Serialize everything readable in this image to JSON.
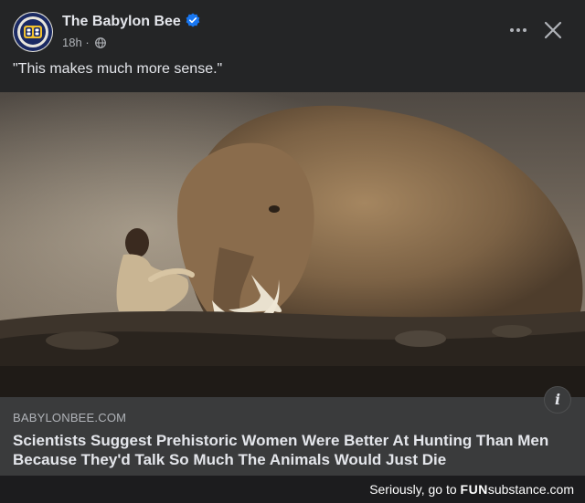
{
  "post": {
    "author": "The Babylon Bee",
    "time": "18h",
    "separator": "·",
    "caption": "\"This makes much more sense.\""
  },
  "icons": {
    "verified": "verified-badge-icon",
    "audience": "globe-icon",
    "more": "more-options-icon",
    "close": "close-icon",
    "info": "info-icon"
  },
  "link": {
    "domain": "BABYLONBEE.COM",
    "headline": "Scientists Suggest Prehistoric Women Were Better At Hunting Than Men Because They'd Talk So Much The Animals Would Just Die",
    "info_glyph": "i"
  },
  "watermark": {
    "lead": "Seriously, go to ",
    "brand_fun": "FUN",
    "brand_substance": "substance",
    "tld": ".com"
  },
  "colors": {
    "background": "#242526",
    "link_bar": "#3a3b3c",
    "verified": "#1877f2",
    "text_primary": "#e4e6eb",
    "text_secondary": "#b0b3b8"
  }
}
